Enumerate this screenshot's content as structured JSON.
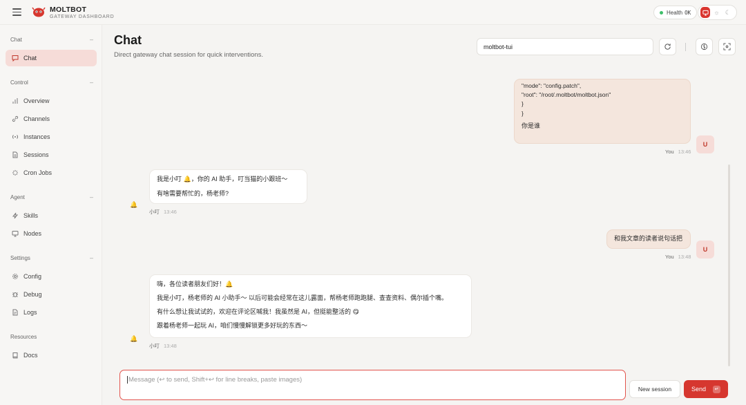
{
  "app": {
    "name": "MOLTBOT",
    "subtitle": "GATEWAY DASHBOARD"
  },
  "health": {
    "label": "Health",
    "value": "OK",
    "status_color": "#3fbf6a"
  },
  "theme": {
    "options": [
      "monitor-icon",
      "sun-icon",
      "moon-icon"
    ],
    "active": "monitor-icon"
  },
  "sidebar": {
    "sections": [
      {
        "title": "Chat",
        "collapse": "–",
        "items": [
          {
            "label": "Chat",
            "icon": "message-icon",
            "active": true
          }
        ]
      },
      {
        "title": "Control",
        "collapse": "–",
        "items": [
          {
            "label": "Overview",
            "icon": "bar-chart-icon"
          },
          {
            "label": "Channels",
            "icon": "link-icon"
          },
          {
            "label": "Instances",
            "icon": "radio-icon"
          },
          {
            "label": "Sessions",
            "icon": "file-icon"
          },
          {
            "label": "Cron Jobs",
            "icon": "loader-icon"
          }
        ]
      },
      {
        "title": "Agent",
        "collapse": "–",
        "items": [
          {
            "label": "Skills",
            "icon": "zap-icon"
          },
          {
            "label": "Nodes",
            "icon": "monitor-icon"
          }
        ]
      },
      {
        "title": "Settings",
        "collapse": "–",
        "items": [
          {
            "label": "Config",
            "icon": "gear-icon"
          },
          {
            "label": "Debug",
            "icon": "bug-icon"
          },
          {
            "label": "Logs",
            "icon": "logs-icon"
          }
        ]
      },
      {
        "title": "Resources",
        "items": [
          {
            "label": "Docs",
            "icon": "book-icon"
          }
        ]
      }
    ]
  },
  "main": {
    "title": "Chat",
    "subtitle": "Direct gateway chat session for quick interventions.",
    "session_value": "moltbot-tui"
  },
  "messages": [
    {
      "role": "user",
      "lines": [
        "\"mode\": \"config.patch\",",
        "\"root\": \"/root/.moltbot/moltbot.json\"",
        "}",
        "}"
      ],
      "text": "你是谁",
      "sender": "You",
      "time": "13:46",
      "avatar": "U"
    },
    {
      "role": "bot",
      "lines": [
        "我是小叮 🔔，你的 AI 助手，叮当猫的小跟班～",
        "有啥需要帮忙的，杨老师?"
      ],
      "sender": "小叮",
      "time": "13:46",
      "avatar": "🔔"
    },
    {
      "role": "user",
      "lines": [
        "和我文章的读者说句话把"
      ],
      "sender": "You",
      "time": "13:48",
      "avatar": "U"
    },
    {
      "role": "bot",
      "lines": [
        "嗨，各位读者朋友们好！🔔",
        "我是小叮，杨老师的 AI 小助手～ 以后可能会经常在这儿露面，帮杨老师跑跑腿、查查资料、偶尔插个嘴。",
        "有什么想让我试试的，欢迎在评论区喊我！我虽然是 AI，但挺能整活的 😋",
        "跟着杨老师一起玩 AI，咱们慢慢解锁更多好玩的东西～"
      ],
      "sender": "小叮",
      "time": "13:48",
      "avatar": "🔔"
    }
  ],
  "composer": {
    "placeholder": "Message (↩ to send, Shift+↩ for line breaks, paste images)",
    "new_session_label": "New session",
    "send_label": "Send",
    "send_kbd": "↵"
  },
  "colors": {
    "accent": "#d6372f",
    "user_bubble": "#f4e6dd",
    "active_nav": "#f6dcd8"
  }
}
